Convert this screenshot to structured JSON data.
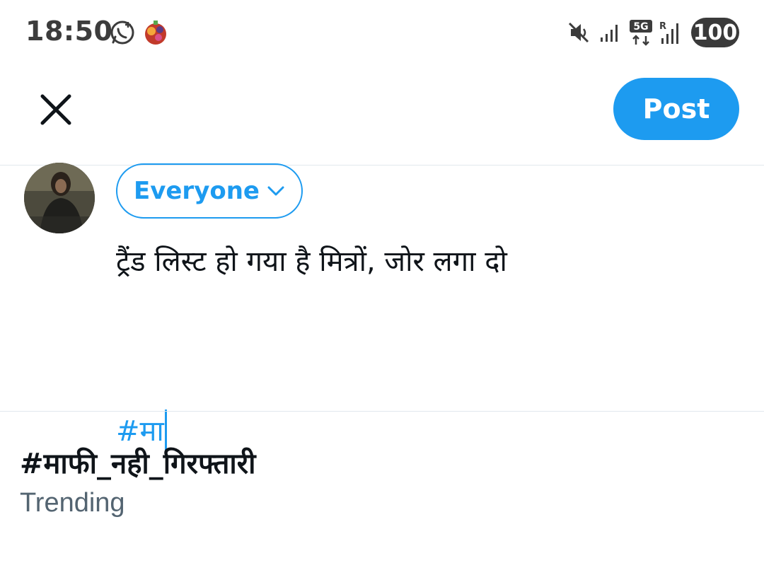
{
  "status_bar": {
    "time": "18:50",
    "battery": "100",
    "icons": [
      "whatsapp-icon",
      "candy-crush-icon",
      "mute-icon",
      "signal-icon",
      "5g-icon",
      "roaming-signal-icon",
      "battery-icon"
    ]
  },
  "header": {
    "close_icon": "close-icon",
    "post_label": "Post",
    "accent_color": "#1d9bf0"
  },
  "composer": {
    "audience_label": "Everyone",
    "audience_icon": "chevron-down-icon",
    "text_line1": "ट्रैंड लिस्ट हो गया है मित्रों, जोर लगा दो",
    "hashtag_input": "#मा"
  },
  "suggestion": {
    "hashtag": "#माफी_नही_गिरफ्तारी",
    "subtitle": "Trending"
  }
}
